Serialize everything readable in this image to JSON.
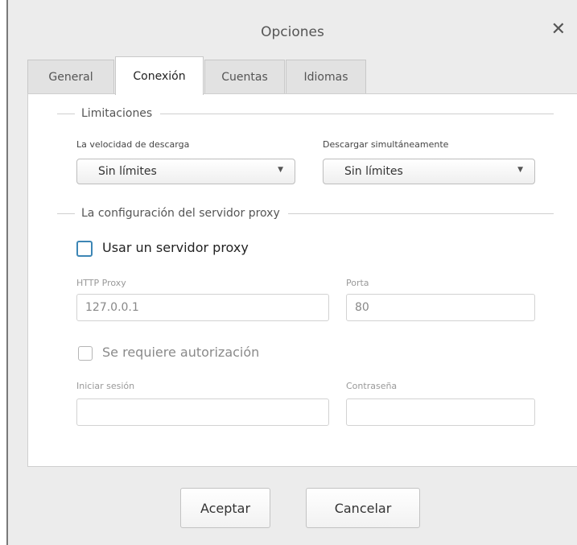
{
  "window": {
    "title": "Opciones",
    "close_glyph": "✕"
  },
  "tabs": [
    {
      "label": "General",
      "active": false
    },
    {
      "label": "Conexión",
      "active": true
    },
    {
      "label": "Cuentas",
      "active": false
    },
    {
      "label": "Idiomas",
      "active": false
    }
  ],
  "limits": {
    "section_title": "Limitaciones",
    "download_speed": {
      "label": "La velocidad de descarga",
      "value": "Sin límites"
    },
    "simultaneous": {
      "label": "Descargar simultáneamente",
      "value": "Sin límites"
    }
  },
  "proxy": {
    "section_title": "La configuración del servidor proxy",
    "use_proxy": {
      "label": "Usar un servidor proxy",
      "checked": false
    },
    "http_proxy": {
      "label": "HTTP Proxy",
      "value": "127.0.0.1"
    },
    "port": {
      "label": "Porta",
      "value": "80"
    },
    "auth_required": {
      "label": "Se requiere autorización",
      "checked": false
    },
    "login": {
      "label": "Iniciar sesión",
      "value": ""
    },
    "password": {
      "label": "Contraseña",
      "value": ""
    }
  },
  "buttons": {
    "accept": "Aceptar",
    "cancel": "Cancelar"
  },
  "colors": {
    "checkbox_accent": "#3d86b5",
    "panel_bg": "#ffffff",
    "window_bg": "#ececec"
  },
  "icons": {
    "close": "close-icon",
    "dropdown": "chevron-down-icon"
  }
}
